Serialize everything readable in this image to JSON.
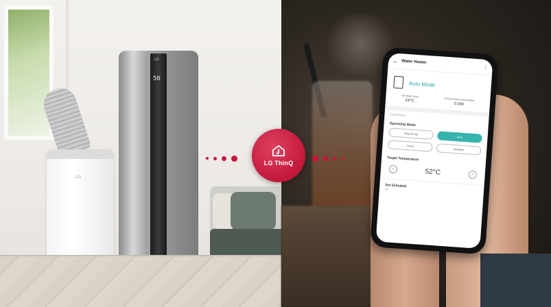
{
  "scene": {
    "accent_color": "#c8153c",
    "room_devices": [
      "portable-air-conditioner",
      "heat-pump-water-heater"
    ],
    "heater_display": "50",
    "heater_logo": "LG",
    "ac_logo": "LG"
  },
  "hub": {
    "label": "LG ThinQ",
    "icon": "home-icon"
  },
  "app": {
    "title": "Water Heater",
    "mode_label": "Auto Mode",
    "stats": [
      {
        "label": "Set Water Temp",
        "value": "24°C"
      },
      {
        "label": "Current Power Consumption",
        "value": "0.0W"
      }
    ],
    "section_label": "CONTROLS",
    "operating_mode_label": "Operating Mode",
    "modes": [
      {
        "label": "Heat Pump",
        "active": false
      },
      {
        "label": "Auto",
        "active": true
      },
      {
        "label": "Turbo",
        "active": false
      },
      {
        "label": "Vacation",
        "active": false
      }
    ],
    "target_temp_label": "Target Temperature",
    "target_temp_value": "52°C",
    "decrease_symbol": "˅",
    "increase_symbol": "˄",
    "schedule_label": "Set Schedule",
    "schedule_sub": "Off",
    "accent_color": "#37b3ae"
  }
}
